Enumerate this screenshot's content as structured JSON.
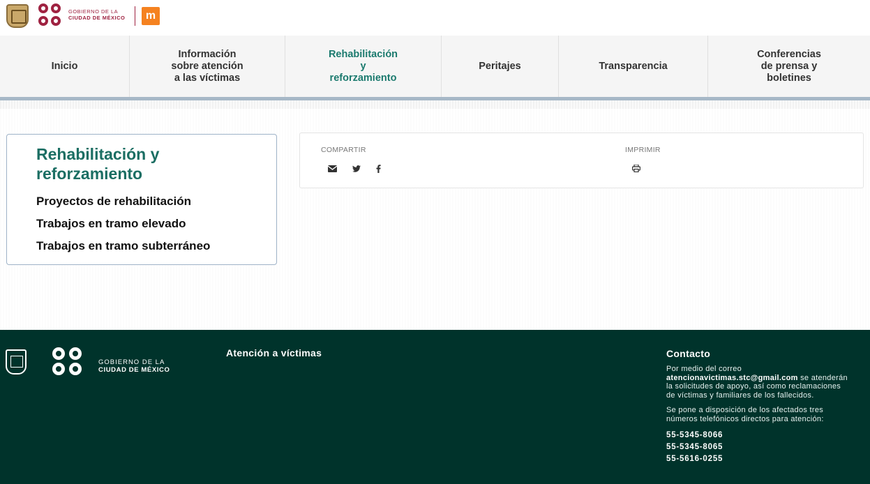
{
  "header": {
    "gov_line1": "GOBIERNO DE LA",
    "gov_line2": "CIUDAD DE MÉXICO",
    "metro_logo_icon": "metro-m-logo",
    "brand_color": "#9f2241",
    "metro_color": "#f58220"
  },
  "nav": {
    "items": [
      {
        "label": "Inicio"
      },
      {
        "label": "Información\nsobre atención\na las víctimas"
      },
      {
        "label": "Rehabilitación\ny\nreforzamiento"
      },
      {
        "label": "Peritajes"
      },
      {
        "label": "Transparencia"
      },
      {
        "label": "Conferencias\nde prensa y\nboletines"
      }
    ],
    "active_color": "#1b7a6e"
  },
  "sidebar": {
    "title": "Rehabilitación y reforzamiento",
    "links": [
      {
        "label": "Proyectos de rehabilitación"
      },
      {
        "label": "Trabajos en tramo elevado"
      },
      {
        "label": "Trabajos en tramo subterráneo"
      }
    ]
  },
  "share": {
    "share_label": "COMPARTIR",
    "print_label": "IMPRIMIR",
    "icons": [
      "envelope-icon",
      "twitter-icon",
      "facebook-icon",
      "print-icon"
    ]
  },
  "footer": {
    "gov_line1": "GOBIERNO DE LA",
    "gov_line2": "CIUDAD DE MÉXICO",
    "section_heading": "Atención a víctimas",
    "contact": {
      "heading": "Contacto",
      "p1_before": "Por medio del correo ",
      "email": "atencionavictimas.stc@gmail.com",
      "p1_after": " se atenderán la solicitudes de apoyo, así como reclamaciones de víctimas y familiares de los fallecidos.",
      "p2": "Se pone a disposición de los afectados tres números telefónicos directos para atención:",
      "phones": [
        "55-5345-8066",
        "55-5345-8065",
        "55-5616-0255"
      ]
    },
    "bg_color": "#00332b"
  }
}
